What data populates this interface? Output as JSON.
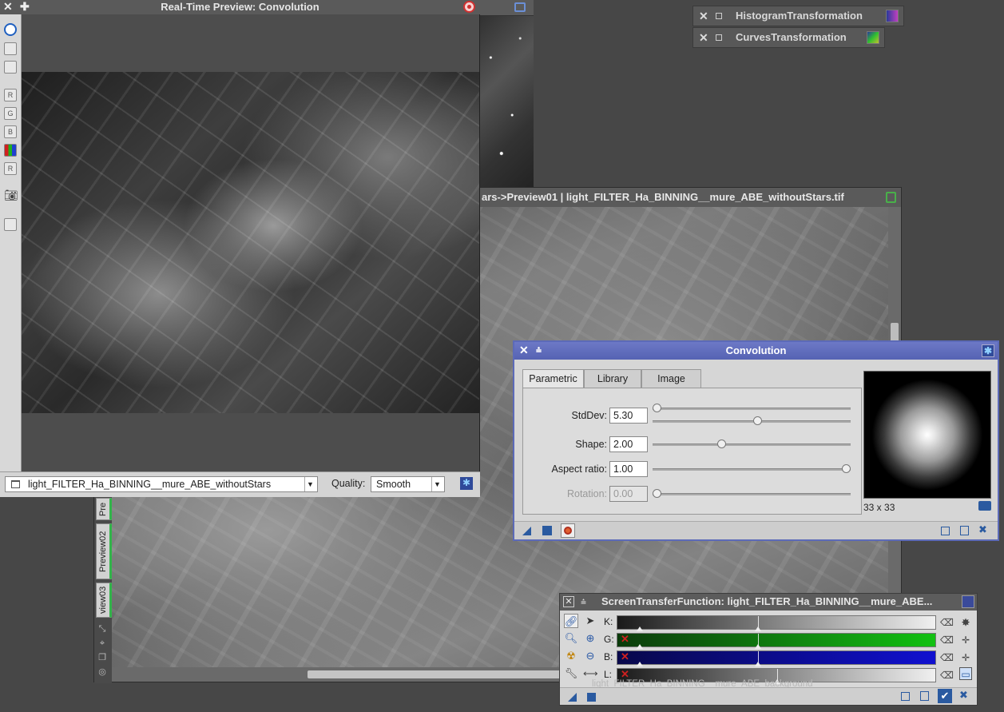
{
  "rtp": {
    "title": "Real-Time Preview: Convolution",
    "target_view": "light_FILTER_Ha_BINNING__mure_ABE_withoutStars",
    "quality_label": "Quality:",
    "quality_value": "Smooth",
    "toolbar_letters": [
      "R",
      "G",
      "B",
      "",
      "R"
    ]
  },
  "main_window": {
    "title": "ars->Preview01 | light_FILTER_Ha_BINNING__mure_ABE_withoutStars.tif",
    "tabs": [
      "Pre",
      "Preview02",
      "view03"
    ]
  },
  "process_icons": [
    {
      "label": "HistogramTransformation"
    },
    {
      "label": "CurvesTransformation"
    }
  ],
  "convolution": {
    "title": "Convolution",
    "tabs": [
      "Parametric",
      "Library",
      "Image"
    ],
    "active_tab": "Parametric",
    "params": {
      "stddev": {
        "label": "StdDev:",
        "value": "5.30"
      },
      "shape": {
        "label": "Shape:",
        "value": "2.00"
      },
      "aspect": {
        "label": "Aspect ratio:",
        "value": "1.00"
      },
      "rotation": {
        "label": "Rotation:",
        "value": "0.00"
      }
    },
    "slider_levels": {
      "stddev_coarse": 0.0,
      "stddev_fine": 0.53,
      "shape": 0.34,
      "aspect": 1.0,
      "rotation": 0.0
    },
    "kernel_size": "33 x 33"
  },
  "stf": {
    "title": "ScreenTransferFunction: light_FILTER_Ha_BINNING__mure_ABE...",
    "channels": [
      {
        "label": "K:",
        "color": "#1a1a1a",
        "color_end": "#f0f0f0",
        "disabled": false
      },
      {
        "label": "G:",
        "color": "#0b3a0b",
        "color_end": "#13c113",
        "disabled": true
      },
      {
        "label": "B:",
        "color": "#08084a",
        "color_end": "#1010d0",
        "disabled": true
      },
      {
        "label": "L:",
        "color": "#1a1a1a",
        "color_end": "#f0f0f0",
        "disabled": true
      }
    ],
    "ghost_view": "light_FILTER_Ha_BINNING__mure_ABE_background"
  }
}
